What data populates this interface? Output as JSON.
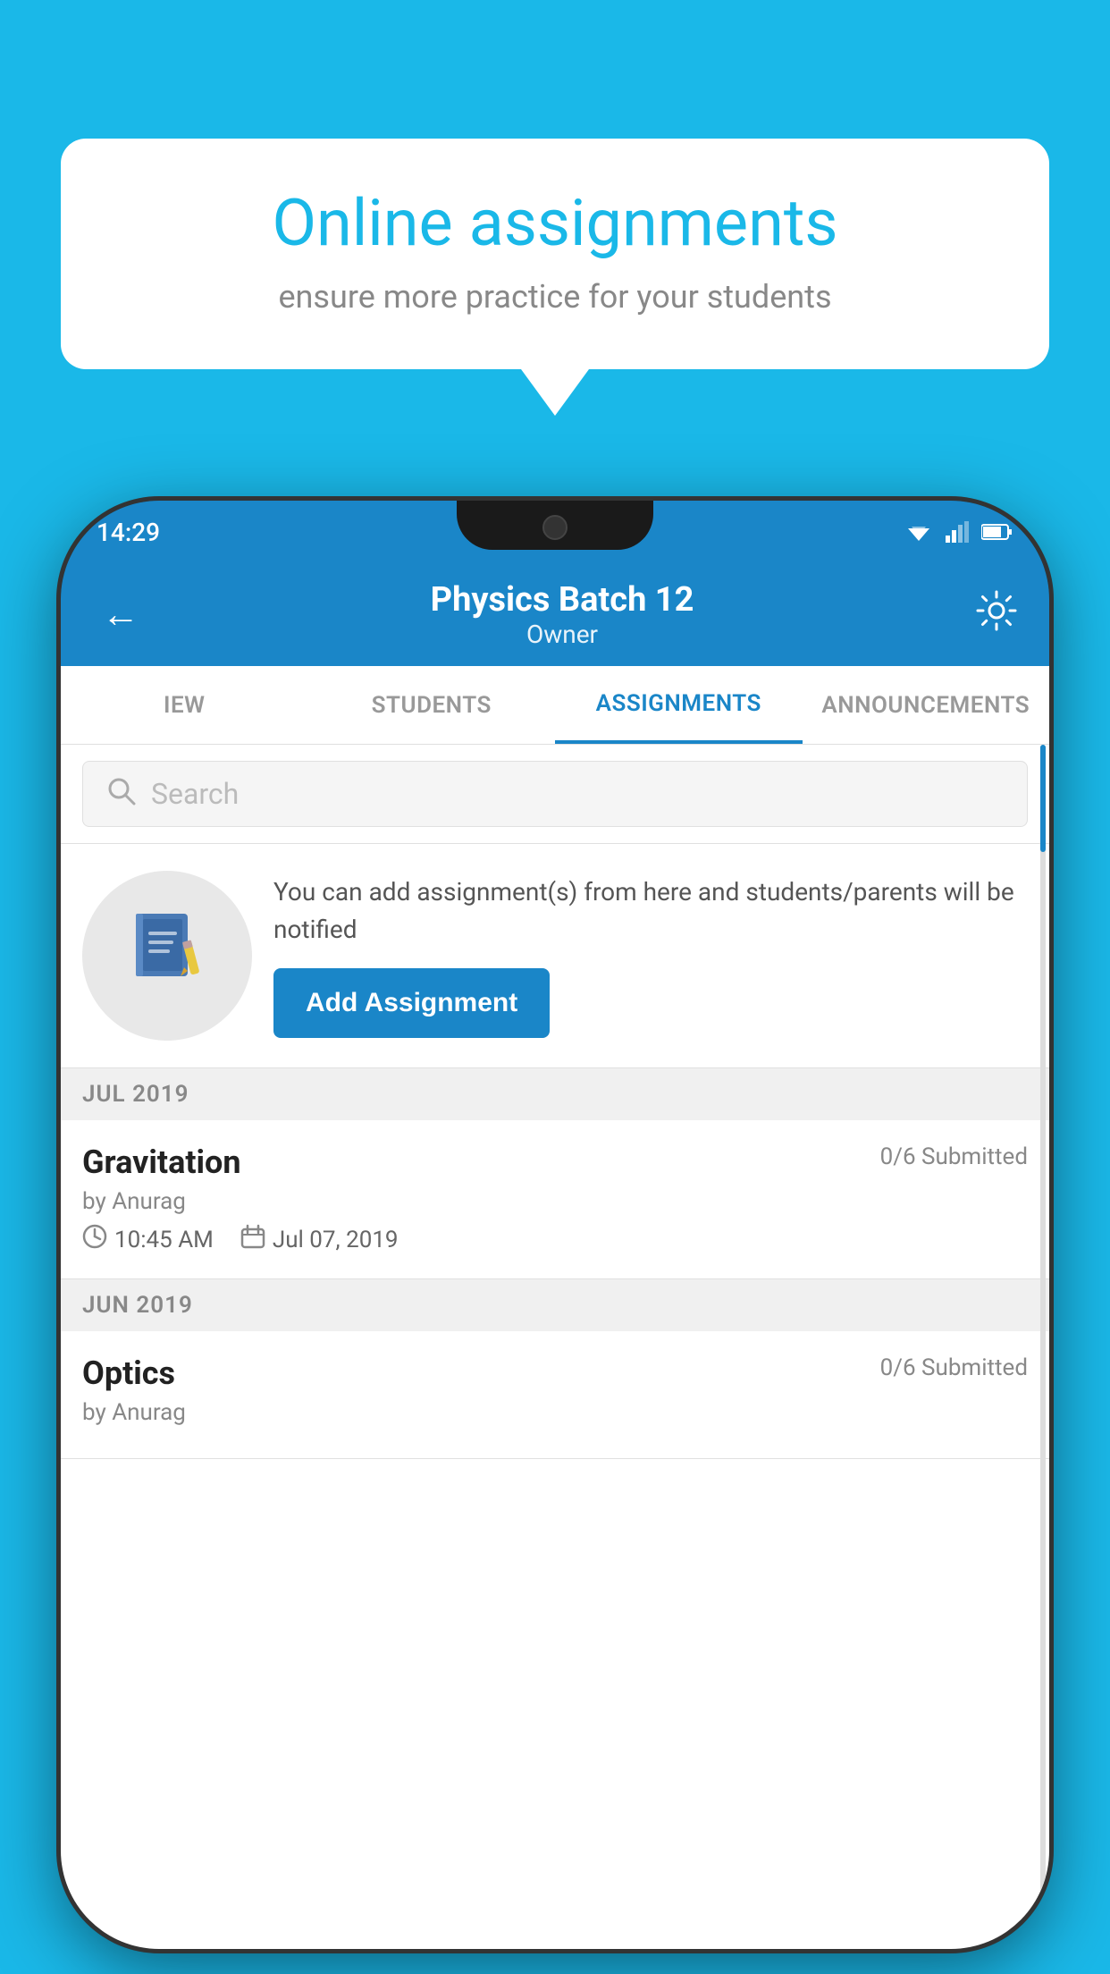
{
  "background_color": "#1ab8e8",
  "speech_bubble": {
    "title": "Online assignments",
    "subtitle": "ensure more practice for your students"
  },
  "status_bar": {
    "time": "14:29"
  },
  "app_bar": {
    "title": "Physics Batch 12",
    "subtitle": "Owner",
    "back_label": "←",
    "settings_label": "⚙"
  },
  "tabs": [
    {
      "label": "IEW",
      "active": false
    },
    {
      "label": "STUDENTS",
      "active": false
    },
    {
      "label": "ASSIGNMENTS",
      "active": true
    },
    {
      "label": "ANNOUNCEMENTS",
      "active": false
    }
  ],
  "search": {
    "placeholder": "Search"
  },
  "promo": {
    "description": "You can add assignment(s) from here and students/parents will be notified",
    "add_button_label": "Add Assignment"
  },
  "sections": [
    {
      "label": "JUL 2019",
      "assignments": [
        {
          "name": "Gravitation",
          "submitted": "0/6 Submitted",
          "by": "by Anurag",
          "time": "10:45 AM",
          "date": "Jul 07, 2019"
        }
      ]
    },
    {
      "label": "JUN 2019",
      "assignments": [
        {
          "name": "Optics",
          "submitted": "0/6 Submitted",
          "by": "by Anurag",
          "time": "",
          "date": ""
        }
      ]
    }
  ]
}
